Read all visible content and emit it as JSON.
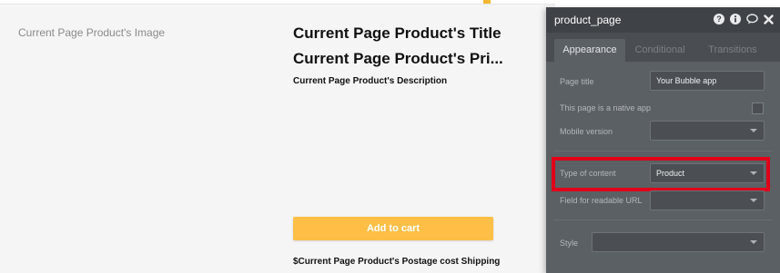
{
  "page": {
    "image_label": "Current Page Product's Image",
    "title": "Current Page Product's Title",
    "price": "Current Page Product's Pri...",
    "description": "Current Page Product's Description",
    "add_to_cart_label": "Add to cart",
    "postage_text": "$Current Page Product's Postage cost Shipping"
  },
  "panel": {
    "title": "product_page",
    "tabs": [
      "Appearance",
      "Conditional",
      "Transitions"
    ],
    "fields": {
      "page_title": {
        "label": "Page title",
        "value": "Your Bubble app"
      },
      "native_app": {
        "label": "This page is a native app"
      },
      "mobile_version": {
        "label": "Mobile version",
        "value": ""
      },
      "type_of_content": {
        "label": "Type of content",
        "value": "Product"
      },
      "readable_url": {
        "label": "Field for readable URL",
        "value": ""
      },
      "style": {
        "label": "Style",
        "value": ""
      }
    },
    "icons": [
      "help-icon",
      "info-icon",
      "comment-icon",
      "close-icon"
    ]
  },
  "colors": {
    "accent": "#ffbf47",
    "highlight": "#e0001a",
    "panel_bg": "#5b6065",
    "panel_header": "#3f4347"
  }
}
